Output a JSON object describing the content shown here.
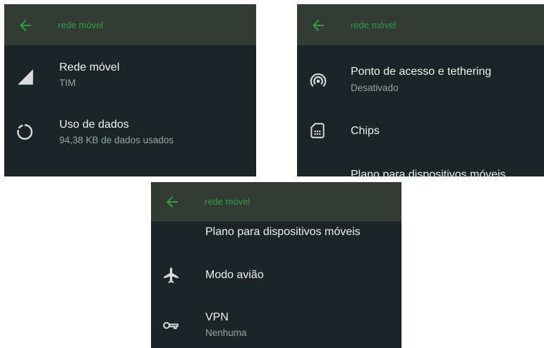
{
  "panel1": {
    "title": "rede móvel",
    "items": [
      {
        "icon": "signal-icon",
        "title": "Rede móvel",
        "subtitle": "TIM"
      },
      {
        "icon": "data-usage-icon",
        "title": "Uso de dados",
        "subtitle": "94,38 KB de dados usados"
      }
    ]
  },
  "panel2": {
    "title": "rede móvel",
    "items": [
      {
        "icon": "hotspot-icon",
        "title": "Ponto de acesso e tethering",
        "subtitle": "Desativado"
      },
      {
        "icon": "sim-card-icon",
        "title": "Chips"
      },
      {
        "title": "Plano para dispositivos móveis"
      }
    ]
  },
  "panel3": {
    "title": "rede móvel",
    "items": [
      {
        "title": "Plano para dispositivos móveis"
      },
      {
        "icon": "airplane-icon",
        "title": "Modo avião"
      },
      {
        "icon": "vpn-key-icon",
        "title": "VPN",
        "subtitle": "Nenhuma"
      }
    ]
  },
  "colors": {
    "background": "#1b2527",
    "appbar": "#343b35",
    "accent": "#2ea043",
    "text": "#eef2f1",
    "subtext": "#9aa3a1"
  }
}
